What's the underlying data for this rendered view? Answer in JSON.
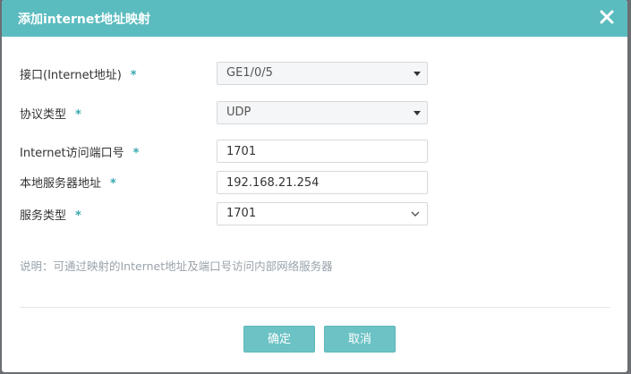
{
  "dialog": {
    "title": "添加internet地址映射",
    "close_icon": "close-icon"
  },
  "form": {
    "interface": {
      "label": "接口(Internet地址)",
      "required": "*",
      "value": "GE1/0/5"
    },
    "protocol": {
      "label": "协议类型",
      "required": "*",
      "value": "UDP"
    },
    "internet_port": {
      "label": "Internet访问端口号",
      "required": "*",
      "value": "1701"
    },
    "local_server": {
      "label": "本地服务器地址",
      "required": "*",
      "value": "192.168.21.254"
    },
    "service_type": {
      "label": "服务类型",
      "required": "*",
      "value": "1701"
    }
  },
  "note": "说明：可通过映射的Internet地址及端口号访问内部网络服务器",
  "buttons": {
    "confirm": "确定",
    "cancel": "取消"
  },
  "colors": {
    "accent": "#5bbcbf",
    "required_star": "#3aa8b0",
    "button": "#6cc2c5"
  }
}
